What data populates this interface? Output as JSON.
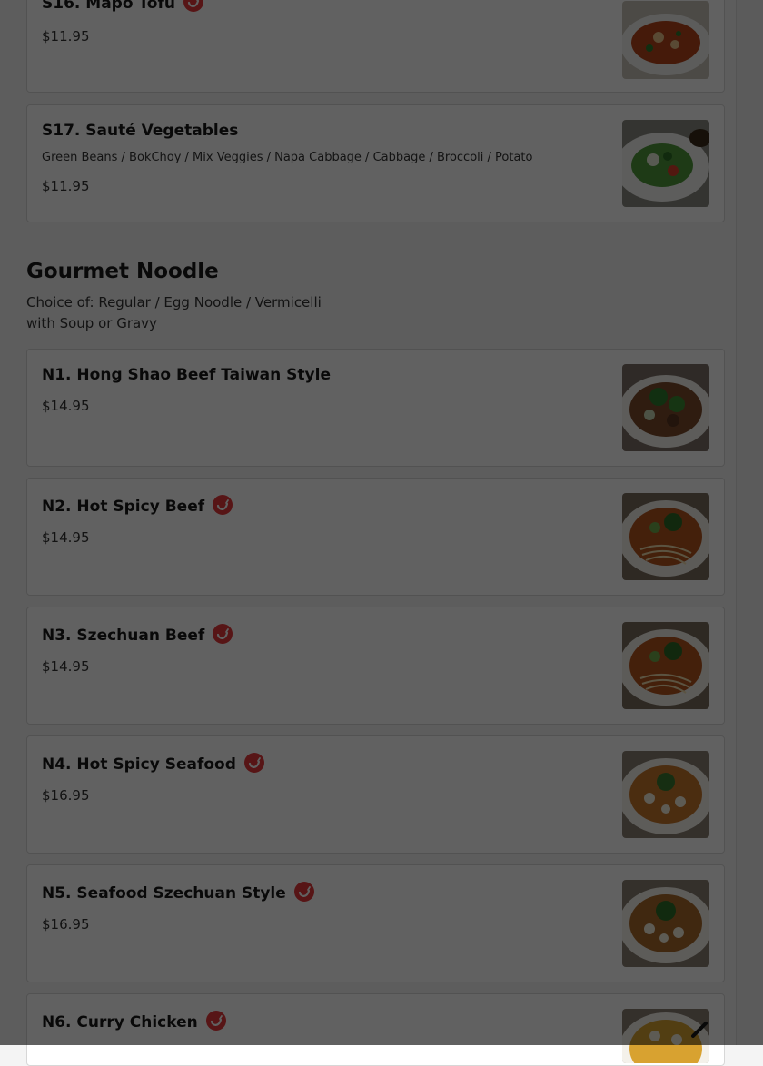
{
  "top_items": [
    {
      "name": "S16. Mapo Tofu",
      "spicy": true,
      "description": "",
      "price": "$11.95",
      "image": "mapo-tofu-dish"
    },
    {
      "name": "S17. Sauté Vegetables",
      "spicy": false,
      "description": "Green Beans / BokChoy / Mix Veggies / Napa Cabbage / Cabbage / Broccoli / Potato",
      "price": "$11.95",
      "image": "vegetable-dish"
    }
  ],
  "section": {
    "title": "Gourmet Noodle",
    "subtitle_line1": "Choice of: Regular / Egg Noodle / Vermicelli",
    "subtitle_line2": "with Soup or Gravy"
  },
  "noodle_items": [
    {
      "name": "N1. Hong Shao Beef Taiwan Style",
      "spicy": false,
      "price": "$14.95",
      "image": "beef-noodle-soup"
    },
    {
      "name": "N2. Hot Spicy Beef",
      "spicy": true,
      "price": "$14.95",
      "image": "spicy-beef-noodle"
    },
    {
      "name": "N3. Szechuan Beef",
      "spicy": true,
      "price": "$14.95",
      "image": "szechuan-beef-noodle"
    },
    {
      "name": "N4. Hot Spicy Seafood",
      "spicy": true,
      "price": "$16.95",
      "image": "spicy-seafood-noodle"
    },
    {
      "name": "N5. Seafood Szechuan Style",
      "spicy": true,
      "price": "$16.95",
      "image": "seafood-szechuan-noodle"
    },
    {
      "name": "N6. Curry Chicken",
      "spicy": true,
      "price": "",
      "image": "curry-chicken-noodle"
    }
  ],
  "colors": {
    "spicy_badge": "#e5393b",
    "overlay": "rgba(0,0,0,0.62)",
    "card_bg": "#ffffff"
  }
}
